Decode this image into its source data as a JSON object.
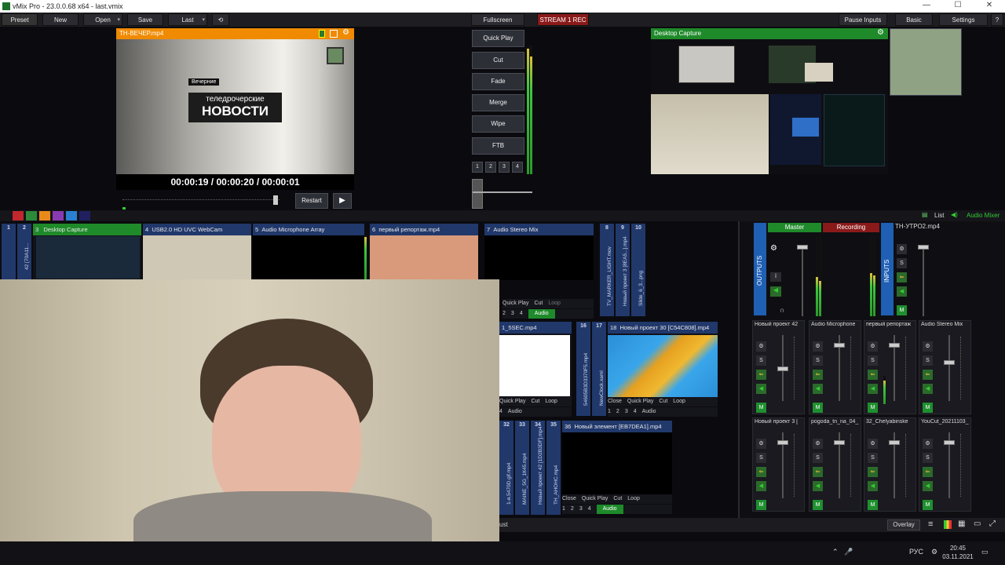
{
  "window": {
    "title": "vMix Pro - 23.0.0.68 x64 - last.vmix",
    "minimize": "—",
    "maximize": "☐",
    "close": "✕"
  },
  "menu": {
    "preset": "Preset",
    "new": "New",
    "open": "Open",
    "save": "Save",
    "last": "Last",
    "fullscreen": "Fullscreen",
    "stream": "STREAM 1 REC",
    "pause_inputs": "Pause Inputs",
    "basic": "Basic",
    "settings": "Settings",
    "help": "?"
  },
  "preview": {
    "title": "ТН-ВЕЧЕР.mp4",
    "small_label": "Вечерние",
    "brand_line1": "теледрочерские",
    "brand_line2": "НОВОСТИ",
    "timecode": "00:00:19  /  00:00:20  /  00:00:01",
    "restart": "Restart"
  },
  "controls": {
    "quick_play": "Quick Play",
    "cut": "Cut",
    "fade": "Fade",
    "merge": "Merge",
    "wipe": "Wipe",
    "ftb": "FTB",
    "numbers": [
      "1",
      "2",
      "3",
      "4"
    ]
  },
  "output": {
    "title": "Desktop Capture"
  },
  "toolbar2": {
    "list": "List",
    "audio_mixer": "Audio Mixer"
  },
  "color_tags": [
    "#c0282d",
    "#2c8a3a",
    "#e88a1a",
    "#8a3ab0",
    "#2a7fd0",
    "#202060"
  ],
  "inputs": {
    "head_row": [
      {
        "n": "1",
        "label": ""
      },
      {
        "n": "2",
        "label": "42 [70A11..."
      },
      {
        "n": "3",
        "label": "Desktop Capture"
      },
      {
        "n": "4",
        "label": "USB2.0 HD UVC WebCam"
      },
      {
        "n": "5",
        "label": "Audio Microphone Array"
      },
      {
        "n": "6",
        "label": "первый репортаж.mp4"
      },
      {
        "n": "7",
        "label": "Audio Stereo Mix"
      },
      {
        "n": "8",
        "label": "TV_MARKER_LIGHT.mov"
      },
      {
        "n": "9",
        "label": "Новый проект 3 [8EA5...].mp4"
      },
      {
        "n": "10",
        "label": "Slide_6_3...png"
      }
    ],
    "row2": [
      {
        "n": "",
        "label": "1_5SEC.mp4"
      },
      {
        "n": "16",
        "label": "54605B3D3370F5.mp4"
      },
      {
        "n": "17",
        "label": "NewClock.xaml"
      },
      {
        "n": "18",
        "label": "Новый проект 30 [C54C808].mp4"
      }
    ],
    "row3": [
      {
        "n": "32",
        "label": "1-я.5470D.gif.mp4"
      },
      {
        "n": "33",
        "label": "MAINE_5G_1К45.mp4"
      },
      {
        "n": "34",
        "label": "Новый проект 42 [1D2B3DF].mp4"
      },
      {
        "n": "35",
        "label": "ТН_АНОНС.mp4"
      },
      {
        "n": "36",
        "label": "Новый элемент [EB7DEA1].mp4"
      }
    ],
    "bar_labels": {
      "close": "Close",
      "quick_play": "Quick Play",
      "cut": "Cut",
      "loop": "Loop",
      "audio": "Audio",
      "nums": [
        "1",
        "2",
        "3",
        "4"
      ]
    }
  },
  "mixer": {
    "master": "Master",
    "recording": "Recording",
    "outputs": "OUTPUTS",
    "inputs": "INPUTS",
    "strip_top": "ТН-УТРО2.mp4",
    "strips_row1": [
      "Новый проект 42",
      "Audio Microphone",
      "первый репортаж",
      "Audio Stereo Mix"
    ],
    "strips_row2": [
      "Новый проект 3 [",
      "pogoda_tn_na_04_",
      "32_Chelyabinske",
      "YouCut_20211103_"
    ],
    "m": "M",
    "s": "S"
  },
  "bottom": {
    "overlay": "Overlay",
    "left_fragment": "ust"
  },
  "tray": {
    "lang": "РУС",
    "time": "20:45",
    "date": "03.11.2021"
  }
}
